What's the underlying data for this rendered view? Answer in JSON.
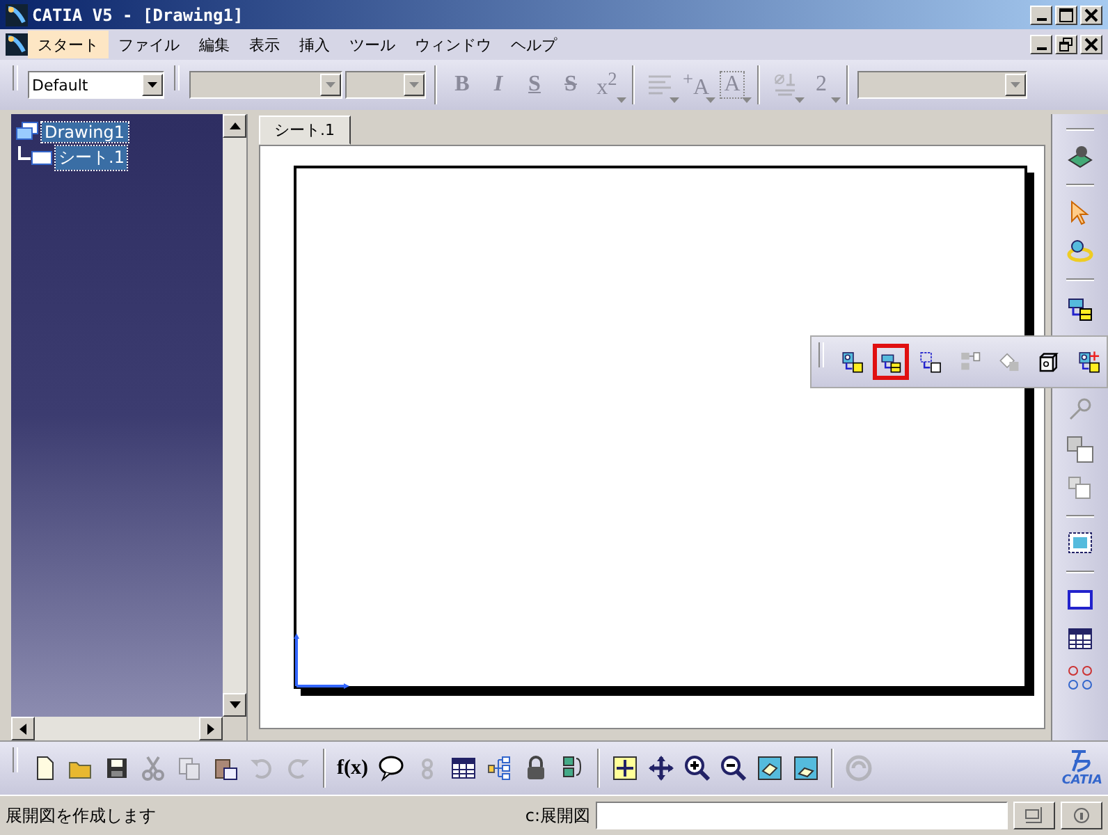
{
  "window": {
    "title": "CATIA V5 - [Drawing1]"
  },
  "menu": [
    {
      "label": "スタート",
      "selected": true
    },
    {
      "label": "ファイル",
      "selected": false
    },
    {
      "label": "編集",
      "selected": false
    },
    {
      "label": "表示",
      "selected": false
    },
    {
      "label": "挿入",
      "selected": false
    },
    {
      "label": "ツール",
      "selected": false
    },
    {
      "label": "ウィンドウ",
      "selected": false
    },
    {
      "label": "ヘルプ",
      "selected": false
    }
  ],
  "format_toolbar": {
    "style_value": "Default",
    "tools": [
      {
        "kind": "bold",
        "label": "B",
        "disabled": true
      },
      {
        "kind": "italic",
        "label": "I",
        "disabled": true
      },
      {
        "kind": "underline",
        "label": "S",
        "disabled": true
      },
      {
        "kind": "strike",
        "label": "S",
        "disabled": true
      },
      {
        "kind": "superscript",
        "label": "x$^{2}$",
        "disabled": true
      },
      {
        "kind": "align",
        "disabled": true
      },
      {
        "kind": "text-size",
        "label": "$^{+}$A",
        "disabled": true
      },
      {
        "kind": "frame",
        "label": "A",
        "disabled": true
      },
      {
        "kind": "datum",
        "disabled": true
      },
      {
        "kind": "dimension",
        "label": "2",
        "disabled": true
      }
    ]
  },
  "tree": {
    "label": "Drawing1",
    "selected": true,
    "children": [
      {
        "label": "シート.1",
        "selected": true
      }
    ]
  },
  "tabs": [
    {
      "label": "シート.1",
      "selected": true
    }
  ],
  "right_toolbar": [
    {
      "kind": "sheet"
    },
    {
      "kind": "pointer"
    },
    {
      "kind": "rotate"
    },
    {
      "kind": "box-view"
    },
    {
      "kind": "shapes"
    },
    {
      "kind": "cube-views"
    },
    {
      "kind": "boxes"
    },
    {
      "kind": "grid-frame"
    },
    {
      "kind": "rectangle"
    },
    {
      "kind": "grid-table"
    },
    {
      "kind": "circles"
    }
  ],
  "floating_toolbar": [
    {
      "kind": "projection",
      "selected": false
    },
    {
      "kind": "box-view",
      "selected": true
    },
    {
      "kind": "dashed-projection",
      "selected": false
    },
    {
      "kind": "grid-arrow",
      "selected": false
    },
    {
      "kind": "diamond-grid",
      "selected": false
    },
    {
      "kind": "cube",
      "selected": false
    },
    {
      "kind": "projection-plus",
      "selected": false
    }
  ],
  "bottom_toolbar": [
    {
      "kind": "new-document",
      "disabled": false
    },
    {
      "kind": "folder",
      "disabled": false
    },
    {
      "kind": "floppy",
      "disabled": false
    },
    {
      "kind": "scissors",
      "disabled": true
    },
    {
      "kind": "copy",
      "disabled": true
    },
    {
      "kind": "clipboard",
      "disabled": false
    },
    {
      "kind": "undo",
      "disabled": true
    },
    {
      "kind": "redo",
      "disabled": true
    },
    {
      "kind": "separator"
    },
    {
      "kind": "formula",
      "label": "f(x)",
      "disabled": false
    },
    {
      "kind": "speech-bubble",
      "disabled": false
    },
    {
      "kind": "sensor",
      "disabled": true
    },
    {
      "kind": "table",
      "disabled": false
    },
    {
      "kind": "hierarchy",
      "disabled": false
    },
    {
      "kind": "lock",
      "disabled": false
    },
    {
      "kind": "stack",
      "disabled": false
    },
    {
      "kind": "separator"
    },
    {
      "kind": "fit-all",
      "disabled": false
    },
    {
      "kind": "pan",
      "disabled": false
    },
    {
      "kind": "zoom-in",
      "disabled": false
    },
    {
      "kind": "zoom-out",
      "disabled": false
    },
    {
      "kind": "view-cube",
      "disabled": false
    },
    {
      "kind": "view-plane",
      "disabled": false
    },
    {
      "kind": "separator"
    },
    {
      "kind": "swap",
      "disabled": true
    }
  ],
  "logo": {
    "text": "CATIA"
  },
  "status_bar": {
    "message": "展開図を作成します",
    "command_label": "c:展開図"
  }
}
